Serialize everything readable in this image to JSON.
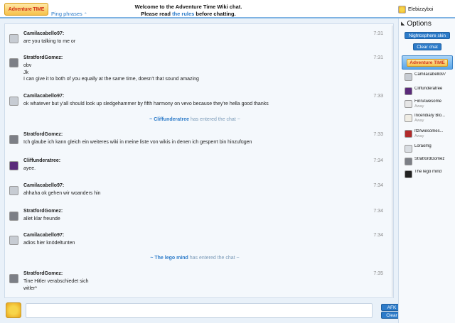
{
  "header": {
    "logo_text": "Adventure TIME",
    "ping_label": "Ping phrases",
    "welcome_line1": "Welcome to the Adventure Time Wiki chat.",
    "welcome_line2_pre": "Please read ",
    "welcome_link": "the rules",
    "welcome_line2_post": " before chatting.",
    "current_user": "Elebizzyboi"
  },
  "messages": [
    {
      "user": "Camilacabello97:",
      "time": "7:31",
      "lines": [
        "are you talking to me or"
      ],
      "avatar_color": "#c7ccd3"
    },
    {
      "user": "StratfordGomez:",
      "time": "7:31",
      "lines": [
        "obv",
        "Jk",
        "I can give it to both of you equally at the same time, doesn't that sound amazing"
      ],
      "avatar_color": "#7c7f86"
    },
    {
      "user": "Camilacabello97:",
      "time": "7:33",
      "lines": [
        "ok whatever but y'all should look up sledgehammer by fifth harmony on vevo because they're hella good thanks"
      ],
      "avatar_color": "#c7ccd3"
    },
    {
      "user": "StratfordGomez:",
      "time": "7:33",
      "lines": [
        "Ich glaube ich kann gleich ein weiteres wiki in meine liste von wikis in denen ich gesperrt bin hinzufügen"
      ],
      "avatar_color": "#7c7f86"
    },
    {
      "user": "Cliffunderatree:",
      "time": "7:34",
      "lines": [
        "ayee."
      ],
      "avatar_color": "#5a2a7a"
    },
    {
      "user": "Camilacabello97:",
      "time": "7:34",
      "lines": [
        "ahhaha ok gehen wir woanders hin"
      ],
      "avatar_color": "#c7ccd3"
    },
    {
      "user": "StratfordGomez:",
      "time": "7:34",
      "lines": [
        "allet klar freunde"
      ],
      "avatar_color": "#7c7f86"
    },
    {
      "user": "Camilacabello97:",
      "time": "7:34",
      "lines": [
        "adios hier knödeltunten"
      ],
      "avatar_color": "#c7ccd3"
    },
    {
      "user": "StratfordGomez:",
      "time": "7:35",
      "lines": [
        "Tine Hitler verabschiedet sich",
        "witler*"
      ],
      "avatar_color": "#7c7f86"
    }
  ],
  "events": [
    {
      "name": "~ Cliffunderatree",
      "text": " has entered the chat ~"
    },
    {
      "name": "~ The lego mind",
      "text": " has entered the chat ~"
    }
  ],
  "input": {
    "afk_label": "AFK",
    "clear_label": "Clear"
  },
  "sidebar": {
    "options_title": "Options",
    "nightosphere_label": "Nightosphere skin",
    "clear_chat_label": "Clear chat",
    "banner_text": "Adventure TIME",
    "users": [
      {
        "name": "Camilacabello97",
        "status": "",
        "avatar_color": "#c7ccd3"
      },
      {
        "name": "Cliffunderatree",
        "status": "",
        "avatar_color": "#5a2a7a"
      },
      {
        "name": "FinnAwesome",
        "status": "Away",
        "avatar_color": "#e6e6e6"
      },
      {
        "name": "Incendiary Blo...",
        "status": "Away",
        "avatar_color": "#f0ede4"
      },
      {
        "name": "ItzAwesomes...",
        "status": "Away",
        "avatar_color": "#b22a2a"
      },
      {
        "name": "Loraomg",
        "status": "",
        "avatar_color": "#d9dde2"
      },
      {
        "name": "StratfordGomez",
        "status": "",
        "avatar_color": "#7c7f86"
      },
      {
        "name": "The lego mind",
        "status": "",
        "avatar_color": "#222222"
      }
    ]
  }
}
